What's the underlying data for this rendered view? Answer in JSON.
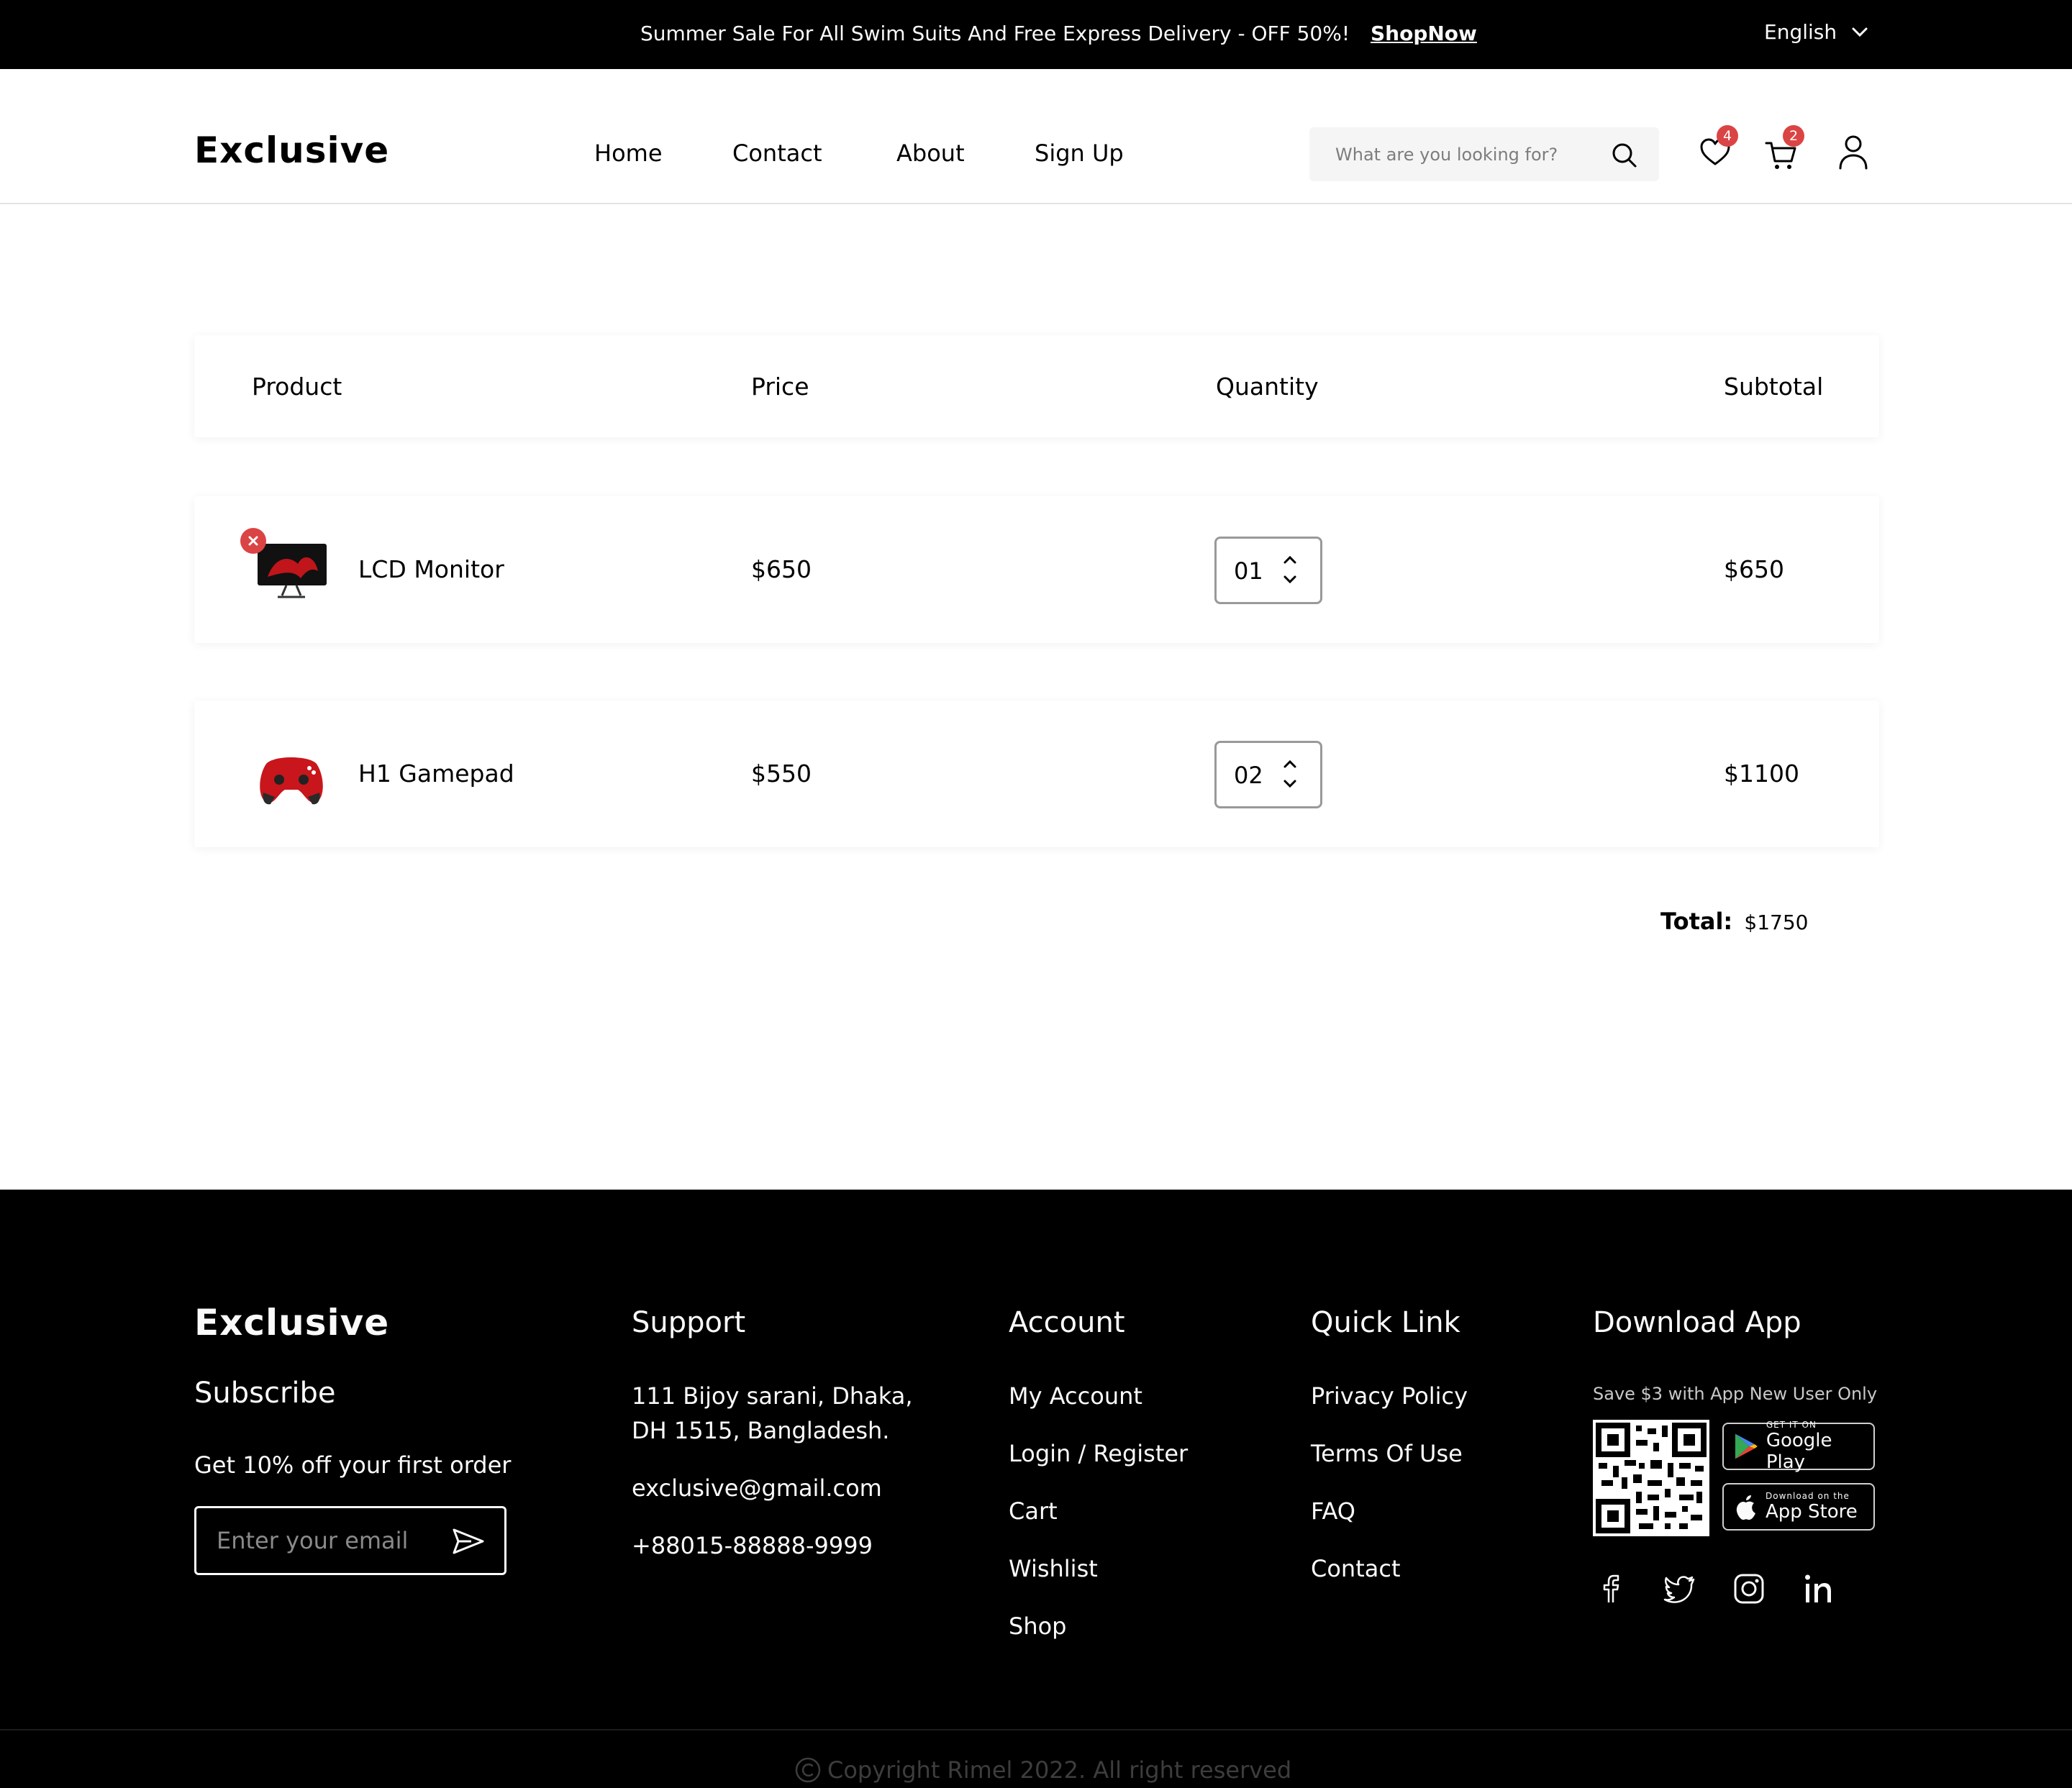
{
  "topbar": {
    "promo": "Summer Sale For All Swim Suits And Free Express Delivery - OFF 50%!",
    "cta": "ShopNow",
    "language": "English"
  },
  "header": {
    "logo": "Exclusive",
    "nav": [
      "Home",
      "Contact",
      "About",
      "Sign Up"
    ],
    "search_placeholder": "What are you looking for?",
    "wishlist_count": "4",
    "cart_count": "2"
  },
  "cart": {
    "columns": [
      "Product",
      "Price",
      "Quantity",
      "Subtotal"
    ],
    "items": [
      {
        "name": "LCD Monitor",
        "price": "$650",
        "quantity": "01",
        "subtotal": "$650"
      },
      {
        "name": "H1 Gamepad",
        "price": "$550",
        "quantity": "02",
        "subtotal": "$1100"
      }
    ],
    "total_label": "Total:",
    "total_value": "$1750"
  },
  "footer": {
    "logo": "Exclusive",
    "subscribe_title": "Subscribe",
    "subscribe_text": "Get 10% off your first order",
    "email_placeholder": "Enter your email",
    "support": {
      "title": "Support",
      "address_line1": "111 Bijoy sarani, Dhaka,",
      "address_line2": "DH 1515, Bangladesh.",
      "email": "exclusive@gmail.com",
      "phone": "+88015-88888-9999"
    },
    "account": {
      "title": "Account",
      "links": [
        "My Account",
        "Login / Register",
        "Cart",
        "Wishlist",
        "Shop"
      ]
    },
    "quick_link": {
      "title": "Quick Link",
      "links": [
        "Privacy Policy",
        "Terms Of Use",
        "FAQ",
        "Contact"
      ]
    },
    "download": {
      "title": "Download App",
      "note": "Save $3 with App New User Only",
      "google_small": "GET IT ON",
      "google_big": "Google Play",
      "apple_small": "Download on the",
      "apple_big": "App Store"
    },
    "copyright": "Copyright Rimel 2022. All right reserved"
  },
  "colors": {
    "accent": "#db4444",
    "dark": "#000000",
    "light": "#fafafa"
  }
}
